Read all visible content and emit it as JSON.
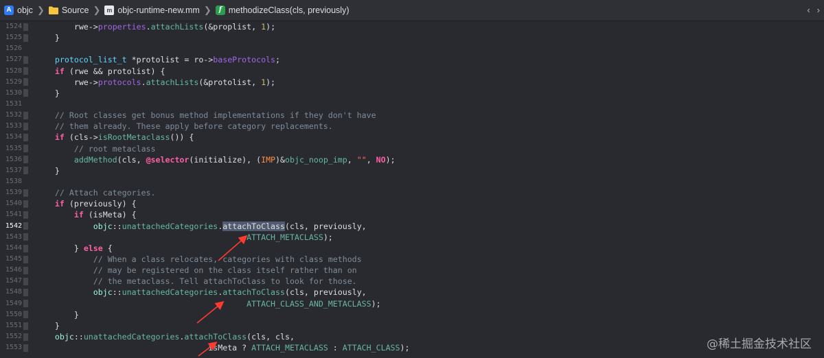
{
  "jumpbar": {
    "crumbs": [
      {
        "label": "objc",
        "icon": "project-icon"
      },
      {
        "label": "Source",
        "icon": "folder-icon"
      },
      {
        "label": "objc-runtime-new.mm",
        "icon": "file-icon"
      },
      {
        "label": "methodizeClass(cls, previously)",
        "icon": "function-icon"
      }
    ],
    "back_glyph": "‹",
    "forward_glyph": "›"
  },
  "editor": {
    "current_line": "1542",
    "lines": [
      {
        "n": "1524",
        "segs": [
          [
            "        ",
            ""
          ],
          [
            "rwe",
            ""
          ],
          [
            "->",
            ""
          ],
          [
            "properties",
            "mem"
          ],
          [
            ".",
            ""
          ],
          [
            "attachLists",
            "ide"
          ],
          [
            "(&proplist, ",
            ""
          ],
          [
            "1",
            "num"
          ],
          [
            ");",
            ""
          ]
        ]
      },
      {
        "n": "1525",
        "segs": [
          [
            "    }",
            ""
          ]
        ]
      },
      {
        "n": "1526",
        "segs": [
          [
            "",
            ""
          ]
        ]
      },
      {
        "n": "1527",
        "segs": [
          [
            "    ",
            ""
          ],
          [
            "protocol_list_t",
            "tp"
          ],
          [
            " *protolist = ro->",
            ""
          ],
          [
            "baseProtocols",
            "mem"
          ],
          [
            ";",
            ""
          ]
        ]
      },
      {
        "n": "1528",
        "segs": [
          [
            "    ",
            ""
          ],
          [
            "if",
            "kw"
          ],
          [
            " (rwe && protolist) {",
            ""
          ]
        ]
      },
      {
        "n": "1529",
        "segs": [
          [
            "        ",
            ""
          ],
          [
            "rwe->",
            ""
          ],
          [
            "protocols",
            "mem"
          ],
          [
            ".",
            ""
          ],
          [
            "attachLists",
            "ide"
          ],
          [
            "(&protolist, ",
            ""
          ],
          [
            "1",
            "num"
          ],
          [
            ");",
            ""
          ]
        ]
      },
      {
        "n": "1530",
        "segs": [
          [
            "    }",
            ""
          ]
        ]
      },
      {
        "n": "1531",
        "segs": [
          [
            "",
            ""
          ]
        ]
      },
      {
        "n": "1532",
        "segs": [
          [
            "    ",
            ""
          ],
          [
            "// Root classes get bonus method implementations if they don't have",
            "cmt"
          ]
        ]
      },
      {
        "n": "1533",
        "segs": [
          [
            "    ",
            ""
          ],
          [
            "// them already. These apply before category replacements.",
            "cmt"
          ]
        ]
      },
      {
        "n": "1534",
        "segs": [
          [
            "    ",
            ""
          ],
          [
            "if",
            "kw"
          ],
          [
            " (cls->",
            ""
          ],
          [
            "isRootMetaclass",
            "ide"
          ],
          [
            "()) {",
            ""
          ]
        ]
      },
      {
        "n": "1535",
        "segs": [
          [
            "        ",
            ""
          ],
          [
            "// root metaclass",
            "cmt"
          ]
        ]
      },
      {
        "n": "1536",
        "segs": [
          [
            "        ",
            ""
          ],
          [
            "addMethod",
            "ide"
          ],
          [
            "(cls, ",
            ""
          ],
          [
            "@selector",
            "kw"
          ],
          [
            "(initialize), (",
            ""
          ],
          [
            "IMP",
            "mac"
          ],
          [
            ")&",
            ""
          ],
          [
            "objc_noop_imp",
            "ide"
          ],
          [
            ", ",
            ""
          ],
          [
            "\"\"",
            "str"
          ],
          [
            ", ",
            ""
          ],
          [
            "NO",
            "kw"
          ],
          [
            ");",
            ""
          ]
        ]
      },
      {
        "n": "1537",
        "segs": [
          [
            "    }",
            ""
          ]
        ]
      },
      {
        "n": "1538",
        "segs": [
          [
            "",
            ""
          ]
        ]
      },
      {
        "n": "1539",
        "segs": [
          [
            "    ",
            ""
          ],
          [
            "// Attach categories.",
            "cmt"
          ]
        ]
      },
      {
        "n": "1540",
        "segs": [
          [
            "    ",
            ""
          ],
          [
            "if",
            "kw"
          ],
          [
            " (previously) {",
            ""
          ]
        ]
      },
      {
        "n": "1541",
        "segs": [
          [
            "        ",
            ""
          ],
          [
            "if",
            "kw"
          ],
          [
            " (isMeta) {",
            ""
          ]
        ]
      },
      {
        "n": "1542",
        "segs": [
          [
            "            ",
            ""
          ],
          [
            "objc",
            "prj"
          ],
          [
            "::",
            ""
          ],
          [
            "unattachedCategories",
            "ide"
          ],
          [
            ".",
            ""
          ],
          [
            "attachToClass",
            "sel"
          ],
          [
            "(cls, previously,",
            ""
          ]
        ]
      },
      {
        "n": "1543",
        "segs": [
          [
            "                                            ",
            ""
          ],
          [
            "ATTACH_METACLASS",
            "ide"
          ],
          [
            ");",
            ""
          ]
        ]
      },
      {
        "n": "1544",
        "segs": [
          [
            "        } ",
            ""
          ],
          [
            "else",
            "kw"
          ],
          [
            " {",
            ""
          ]
        ]
      },
      {
        "n": "1545",
        "segs": [
          [
            "            ",
            ""
          ],
          [
            "// When a class relocates, categories with class methods",
            "cmt"
          ]
        ]
      },
      {
        "n": "1546",
        "segs": [
          [
            "            ",
            ""
          ],
          [
            "// may be registered on the class itself rather than on",
            "cmt"
          ]
        ]
      },
      {
        "n": "1547",
        "segs": [
          [
            "            ",
            ""
          ],
          [
            "// the metaclass. Tell attachToClass to look for those.",
            "cmt"
          ]
        ]
      },
      {
        "n": "1548",
        "segs": [
          [
            "            ",
            ""
          ],
          [
            "objc",
            "prj"
          ],
          [
            "::",
            ""
          ],
          [
            "unattachedCategories",
            "ide"
          ],
          [
            ".",
            ""
          ],
          [
            "attachToClass",
            "ide"
          ],
          [
            "(cls, previously,",
            ""
          ]
        ]
      },
      {
        "n": "1549",
        "segs": [
          [
            "                                            ",
            ""
          ],
          [
            "ATTACH_CLASS_AND_METACLASS",
            "ide"
          ],
          [
            ");",
            ""
          ]
        ]
      },
      {
        "n": "1550",
        "segs": [
          [
            "        }",
            ""
          ]
        ]
      },
      {
        "n": "1551",
        "segs": [
          [
            "    }",
            ""
          ]
        ]
      },
      {
        "n": "1552",
        "segs": [
          [
            "    ",
            ""
          ],
          [
            "objc",
            "prj"
          ],
          [
            "::",
            ""
          ],
          [
            "unattachedCategories",
            "ide"
          ],
          [
            ".",
            ""
          ],
          [
            "attachToClass",
            "ide"
          ],
          [
            "(cls, cls,",
            ""
          ]
        ]
      },
      {
        "n": "1553",
        "segs": [
          [
            "                                    ",
            ""
          ],
          [
            "isMeta ? ",
            ""
          ],
          [
            "ATTACH_METACLASS",
            "ide"
          ],
          [
            " : ",
            ""
          ],
          [
            "ATTACH_CLASS",
            "ide"
          ],
          [
            ");",
            ""
          ]
        ]
      }
    ]
  },
  "colors": {
    "background": "#292a30",
    "keyword": "#fc5fa3",
    "comment": "#7f8c98",
    "arrow": "#ff3b30"
  },
  "watermark": "@稀土掘金技术社区"
}
